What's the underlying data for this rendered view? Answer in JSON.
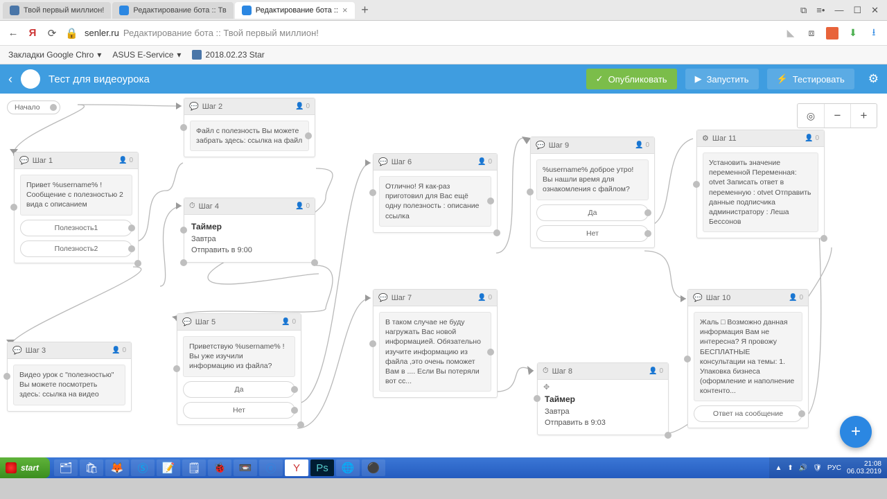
{
  "browser": {
    "tabs": [
      {
        "label": "Твой первый миллион!",
        "favcolor": "#4a76a8"
      },
      {
        "label": "Редактирование бота :: Тв",
        "favcolor": "#2b87e2"
      },
      {
        "label": "Редактирование бота ::",
        "favcolor": "#2b87e2",
        "active": true
      }
    ],
    "url_host": "senler.ru",
    "url_title": "Редактирование бота :: Твой первый миллион!"
  },
  "bookmarks": [
    {
      "label": "Закладки Google Chro"
    },
    {
      "label": "ASUS E-Service"
    },
    {
      "label": "2018.02.23 Star",
      "vk": true
    }
  ],
  "app": {
    "title": "Тест для видеоурока",
    "btn_publish": "Опубликовать",
    "btn_run": "Запустить",
    "btn_test": "Тестировать"
  },
  "start_label": "Начало",
  "blocks": {
    "s1": {
      "title": "Шаг 1",
      "meta": "0",
      "msg": "Привет %username% !\nСообщение с полезностью 2 вида с описанием",
      "opt1": "Полезность1",
      "opt2": "Полезность2"
    },
    "s2": {
      "title": "Шаг 2",
      "meta": "0",
      "msg": "Файл с полезность Вы можете забрать здесь:\nссылка на файл"
    },
    "s3": {
      "title": "Шаг 3",
      "meta": "0",
      "msg": "Видео урок с \"полезностью\" Вы можете посмотреть здесь:\nссылка на видео"
    },
    "s4": {
      "title": "Шаг 4",
      "meta": "0",
      "timer_h": "Таймер",
      "timer_l1": "Завтра",
      "timer_l2": "Отправить в 9:00"
    },
    "s5": {
      "title": "Шаг 5",
      "meta": "0",
      "msg": "Приветствую %username% !\nВы уже изучили информацию из файла?",
      "opt_yes": "Да",
      "opt_no": "Нет"
    },
    "s6": {
      "title": "Шаг 6",
      "meta": "0",
      "msg": "Отлично!\nЯ как-раз приготовил для Вас ещё одну полезность :\nописание\nссылка"
    },
    "s7": {
      "title": "Шаг 7",
      "meta": "0",
      "msg": "В таком случае не буду нагружать Вас новой информацией.\nОбязательно изучите информацию из файла ,это очень поможет Вам в ....\n\nЕсли Вы потеряли вот сс..."
    },
    "s8": {
      "title": "Шаг 8",
      "meta": "0",
      "timer_h": "Таймер",
      "timer_l1": "Завтра",
      "timer_l2": "Отправить в 9:03"
    },
    "s9": {
      "title": "Шаг 9",
      "meta": "0",
      "msg": "%username% доброе утро!\nВы нашли время для ознакомления с файлом?",
      "opt_yes": "Да",
      "opt_no": "Нет"
    },
    "s10": {
      "title": "Шаг 10",
      "meta": "0",
      "msg": "Жаль □\n\nВозможно данная информация Вам не интересна?\nЯ провожу БЕСПЛАТНЫЕ консультации на темы:\n1. Упаковка бизнеса (оформление и наполнение контенто...",
      "opt": "Ответ на сообщение"
    },
    "s11": {
      "title": "Шаг 11",
      "meta": "0",
      "msg": "Установить значение переменной\nПеременная: otvet\n\nЗаписать ответ в переменную :\notvet\n\nОтправить данные подписчика администратору :\nЛеша Бессонов"
    }
  },
  "taskbar": {
    "start": "start",
    "lang": "РУС",
    "time": "21:08",
    "date": "06.03.2019"
  }
}
